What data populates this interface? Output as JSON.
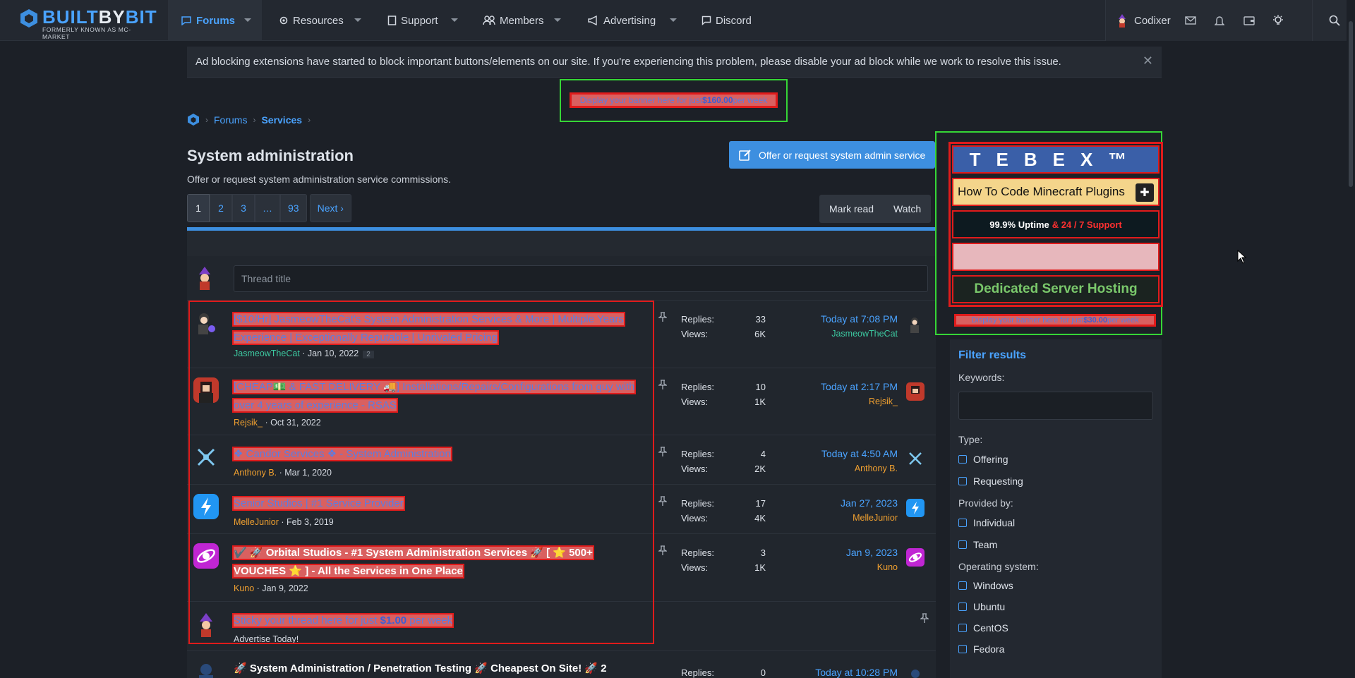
{
  "brand": {
    "name_a": "BUILT",
    "name_b": "BY",
    "name_c": "BIT",
    "subtitle": "FORMERLY KNOWN AS MC-MARKET"
  },
  "nav": {
    "forums": "Forums",
    "resources": "Resources",
    "support": "Support",
    "members": "Members",
    "advertising": "Advertising",
    "discord": "Discord",
    "user": "Codixer"
  },
  "notice": "Ad blocking extensions have started to block important buttons/elements on our site. If you're experiencing this problem, please disable your ad block while we work to resolve this issue.",
  "banner_top": {
    "pre": "Display your banner here for just ",
    "price": "$160.00",
    "post": " per week"
  },
  "breadcrumb": {
    "forums": "Forums",
    "services": "Services"
  },
  "page": {
    "title": "System administration",
    "description": "Offer or request system administration service commissions."
  },
  "offer_button": "Offer or request system admin service",
  "pagination": {
    "pages": [
      "1",
      "2",
      "3",
      "…",
      "93"
    ],
    "next": "Next"
  },
  "actions": {
    "mark_read": "Mark read",
    "watch": "Watch"
  },
  "new_thread_placeholder": "Thread title",
  "threads": [
    {
      "title": "[$10/Hr] JasmeowTheCat's System Administration Services & More | Multiple Years Experience | Exceptionally Reputable | Unrivaled Pricing",
      "author": "JasmeowTheCat",
      "date": "Jan 10, 2022",
      "pages": "2",
      "replies_label": "Replies:",
      "replies": "33",
      "views_label": "Views:",
      "views": "6K",
      "last_date": "Today at 7:08 PM",
      "last_user": "JasmeowTheCat"
    },
    {
      "title": "[CHEAP💵 & FAST DELIVERY 🚚] Installations/Repairs/Configurations from guy with over 4 years of experience - RSAS",
      "author": "Rejsik_",
      "date": "Oct 31, 2022",
      "replies_label": "Replies:",
      "replies": "10",
      "views_label": "Views:",
      "views": "1K",
      "last_date": "Today at 2:17 PM",
      "last_user": "Rejsik_"
    },
    {
      "title": "❖ Candor Services ❖ - System Administration",
      "author": "Anthony B.",
      "date": "Mar 1, 2020",
      "replies_label": "Replies:",
      "replies": "4",
      "views_label": "Views:",
      "views": "2K",
      "last_date": "Today at 4:50 AM",
      "last_user": "Anthony B."
    },
    {
      "title": "Senior Studios | #1 Service Provider",
      "author": "MelleJunior",
      "date": "Feb 3, 2019",
      "replies_label": "Replies:",
      "replies": "17",
      "views_label": "Views:",
      "views": "4K",
      "last_date": "Jan 27, 2023",
      "last_user": "MelleJunior"
    },
    {
      "title": "✔️ 🚀 Orbital Studios - #1 System Administration Services 🚀 [ ⭐ 500+ VOUCHES ⭐ ] - All the Services in One Place",
      "author": "Kuno",
      "date": "Jan 9, 2022",
      "replies_label": "Replies:",
      "replies": "3",
      "views_label": "Views:",
      "views": "1K",
      "last_date": "Jan 9, 2023",
      "last_user": "Kuno"
    },
    {
      "title_pre": "Sticky your thread here for just ",
      "title_price": "$1.00",
      "title_post": " per week",
      "sub": "Advertise Today!"
    },
    {
      "title": "🚀 System Administration / Penetration Testing 🚀 Cheapest On Site! 🚀 2",
      "replies_label": "Replies:",
      "replies": "0",
      "last_date": "Today at 10:28 PM"
    }
  ],
  "side_ads": {
    "tebex": "TEBEX™",
    "mc": "How To Code Minecraft Plugins",
    "uptime_a": "99.9% Uptime",
    "uptime_b": "& 24 / 7 Support",
    "dsh": "Dedicated Server Hosting",
    "small_pre": "Display your banner here for just ",
    "small_price": "$30.00",
    "small_post": " per week"
  },
  "filter": {
    "title": "Filter results",
    "keywords": "Keywords:",
    "type": "Type:",
    "type_opts": [
      "Offering",
      "Requesting"
    ],
    "provided": "Provided by:",
    "provided_opts": [
      "Individual",
      "Team"
    ],
    "os": "Operating system:",
    "os_opts": [
      "Windows",
      "Ubuntu",
      "CentOS",
      "Fedora"
    ]
  }
}
